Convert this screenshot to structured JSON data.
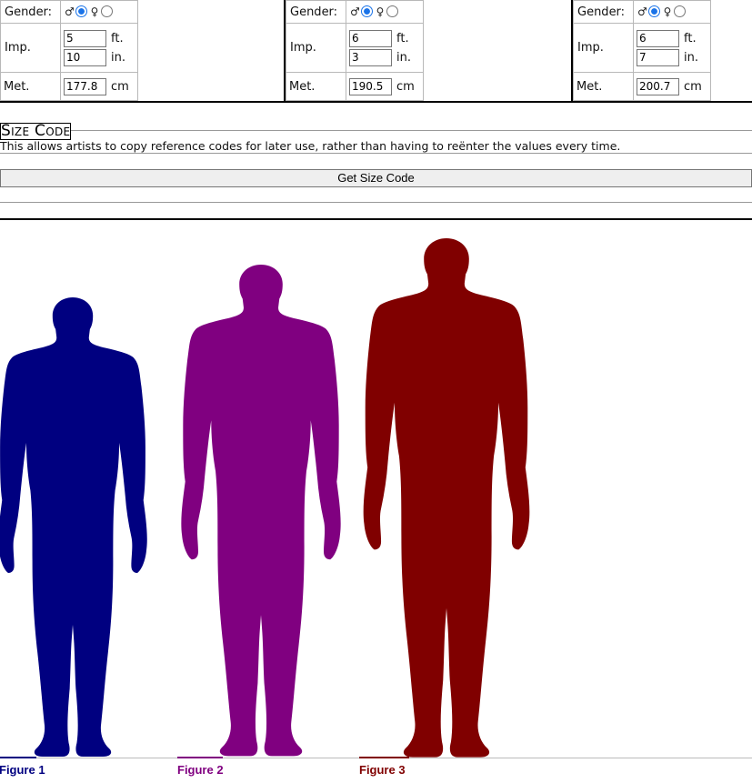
{
  "controls": {
    "gender_label": "Gender:",
    "imp_label": "Imp.",
    "met_label": "Met.",
    "male_symbol": "♂",
    "female_symbol": "♀",
    "ft_unit": "ft.",
    "in_unit": "in.",
    "cm_unit": "cm"
  },
  "figures": [
    {
      "ft": "5",
      "in": "10",
      "cm": "177.8",
      "gender": "male",
      "label": "Figure 1",
      "color": "#000080"
    },
    {
      "ft": "6",
      "in": "3",
      "cm": "190.5",
      "gender": "male",
      "label": "Figure 2",
      "color": "#800080"
    },
    {
      "ft": "6",
      "in": "7",
      "cm": "200.7",
      "gender": "male",
      "label": "Figure 3",
      "color": "#800000"
    }
  ],
  "size_code": {
    "title": "Size Code",
    "description": "This allows artists to copy reference codes for later use, rather than having to reënter the values every time.",
    "button_label": "Get Size Code"
  }
}
